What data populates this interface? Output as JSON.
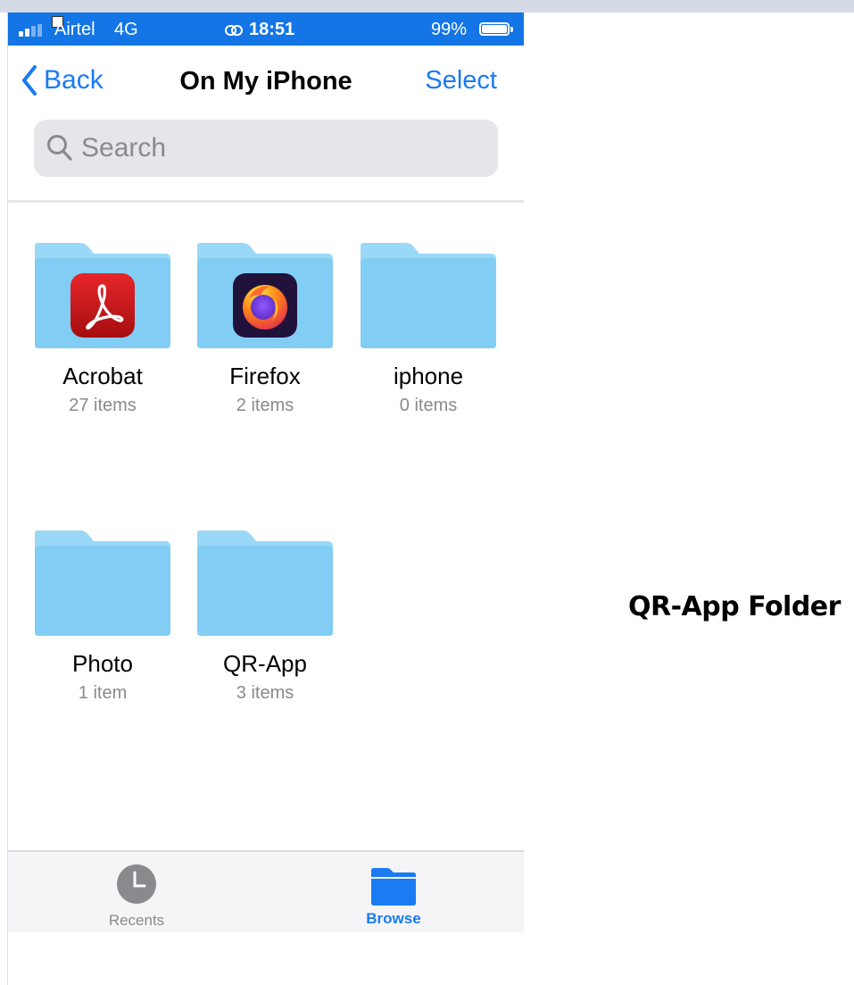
{
  "status_bar": {
    "carrier": "Airtel",
    "network": "4G",
    "time": "18:51",
    "battery_percent": "99%",
    "battery_level": 0.99
  },
  "nav": {
    "back_label": "Back",
    "title": "On My iPhone",
    "select_label": "Select"
  },
  "search": {
    "placeholder": "Search"
  },
  "folders": [
    {
      "name": "Acrobat",
      "count": "27 items",
      "app_icon": "acrobat-icon"
    },
    {
      "name": "Firefox",
      "count": "2 items",
      "app_icon": "firefox-icon"
    },
    {
      "name": "iphone",
      "count": "0 items",
      "app_icon": ""
    },
    {
      "name": "Photo",
      "count": "1 item",
      "app_icon": ""
    },
    {
      "name": "QR-App",
      "count": "3 items",
      "app_icon": ""
    }
  ],
  "tab_bar": {
    "recents_label": "Recents",
    "browse_label": "Browse",
    "active_tab": "Browse"
  },
  "annotation": "QR-App Folder",
  "colors": {
    "accent": "#1a7bf2",
    "status_bar_bg": "#1375e6",
    "folder_light": "#9ad8f7",
    "folder_main": "#82cdf3",
    "inactive_tab": "#8a8a8e"
  }
}
